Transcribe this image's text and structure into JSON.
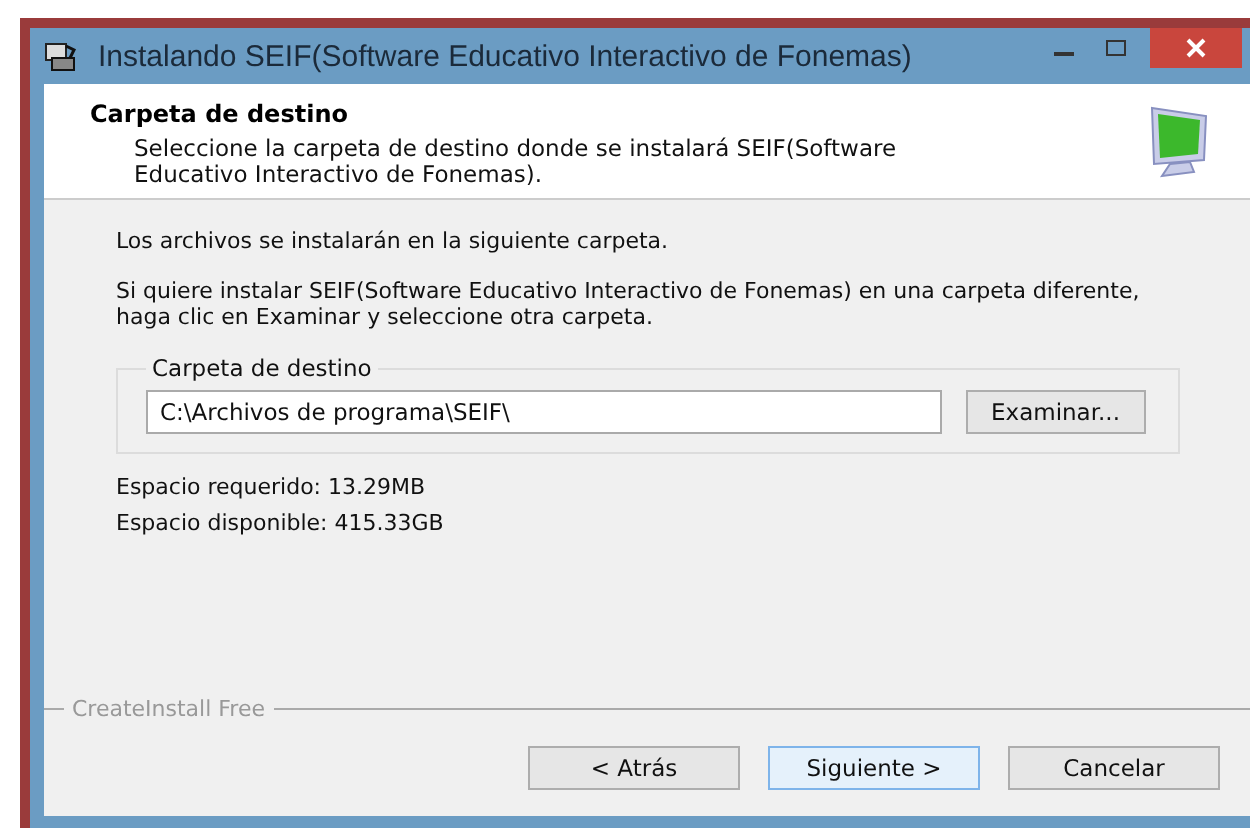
{
  "window": {
    "title": "Instalando SEIF(Software Educativo Interactivo de Fonemas)"
  },
  "header": {
    "title": "Carpeta de destino",
    "subtitle": "Seleccione la carpeta de destino donde se instalará SEIF(Software Educativo Interactivo de Fonemas)."
  },
  "body": {
    "intro": "Los archivos se instalarán en la siguiente carpeta.",
    "instructions": "Si quiere instalar SEIF(Software Educativo Interactivo de Fonemas) en una carpeta diferente, haga clic en Examinar y seleccione otra carpeta.",
    "group": {
      "label": "Carpeta de destino",
      "path": "C:\\Archivos de programa\\SEIF\\",
      "browse_button": "Examinar..."
    },
    "space_required": "Espacio requerido: 13.29MB",
    "space_available": "Espacio disponible: 415.33GB"
  },
  "brand": "CreateInstall Free",
  "buttons": [
    {
      "label": "< Atrás",
      "default": false
    },
    {
      "label": "Siguiente >",
      "default": true
    },
    {
      "label": "Cancelar",
      "default": false
    }
  ]
}
